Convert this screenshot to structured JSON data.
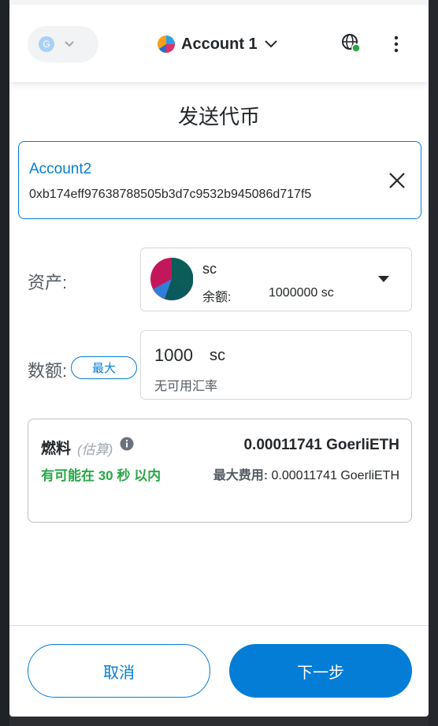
{
  "header": {
    "network_avatar_letter": "G",
    "account_name": "Account 1"
  },
  "page": {
    "title": "发送代币"
  },
  "recipient": {
    "name": "Account2",
    "address": "0xb174eff97638788505b3d7c9532b945086d717f5"
  },
  "asset": {
    "label": "资产:",
    "symbol": "sc",
    "balance_label": "余额:",
    "balance_value": "1000000 sc"
  },
  "amount": {
    "label": "数额:",
    "max_label": "最大",
    "value": "1000",
    "unit": "sc",
    "rate_text": "无可用汇率"
  },
  "gas": {
    "title": "燃料",
    "estimate_label": "(估算)",
    "amount": "0.00011741 GoerliETH",
    "time_text": "有可能在 30 秒 以内",
    "max_fee_label": "最大费用:",
    "max_fee_value": "0.00011741 GoerliETH"
  },
  "footer": {
    "cancel_label": "取消",
    "next_label": "下一步"
  },
  "colors": {
    "primary": "#037dd6",
    "success": "#28a745",
    "text": "#24272a"
  }
}
